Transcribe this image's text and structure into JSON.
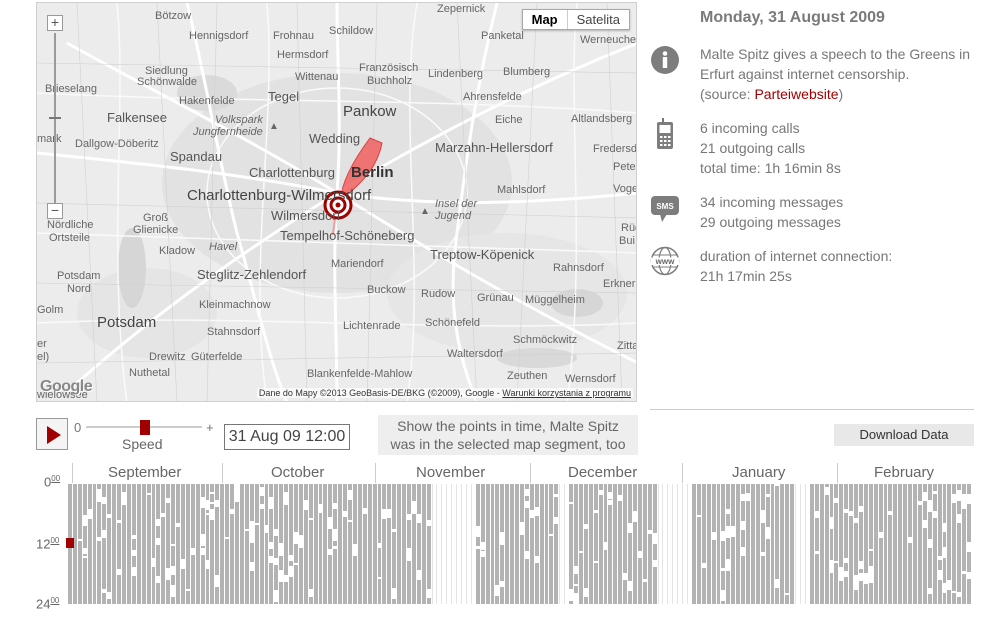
{
  "map": {
    "toggle": {
      "map_label": "Map",
      "satellite_label": "Satelita"
    },
    "zoom": {
      "plus": "+",
      "minus": "−"
    },
    "places": {
      "zepernick": "Zepernick",
      "botzow": "Bötzow",
      "hennigsdorf": "Hennigsdorf",
      "frohnau": "Frohnau",
      "schildow": "Schildow",
      "panketal": "Panketal",
      "werneuchen": "Werneuchen",
      "hermsdorf": "Hermsdorf",
      "siedlung": "Siedlung",
      "schonwalde": "Schönwalde",
      "wittenau": "Wittenau",
      "franzosisch": "Französisch",
      "buchholz": "Buchholz",
      "lindenberg": "Lindenberg",
      "blumberg": "Blumberg",
      "brieselang": "Brieselang",
      "hakenfelde": "Hakenfelde",
      "tegel": "Tegel",
      "ahrensfelde": "Ahrensfelde",
      "pankow": "Pankow",
      "falkensee": "Falkensee",
      "volkspark": "Volkspark",
      "jungfernheide": "Jungfernheide",
      "eiche": "Eiche",
      "altlandsberg": "Altlandsberg",
      "mark": "mark",
      "dallgow": "Dallgow-Döberitz",
      "wedding": "Wedding",
      "marzahn": "Marzahn-Hellersdorf",
      "fredersdorf": "Fredersd",
      "spandau": "Spandau",
      "charlottenburg": "Charlottenburg",
      "berlin": "Berlin",
      "petershagen": "Peter",
      "charlottenburg_wilm": "Charlottenburg-Wilmersdorf",
      "mahlsdorf": "Mahlsdorf",
      "vogelsdorf": "Vogels",
      "insel": "Insel der",
      "jugend": "Jugend",
      "wilmersdorf": "Wilmersdorf",
      "nordliche": "Nördliche",
      "ortsteile": "Ortsteile",
      "gross": "Groß",
      "glienicke": "Glienicke",
      "tempelhof": "Tempelhof-Schöneberg",
      "rud": "Rüd",
      "bui": "Bui",
      "havel": "Havel",
      "kladow": "Kladow",
      "treptow": "Treptow-Köpenick",
      "mariendorf": "Mariendorf",
      "potsdam_nord": "Potsdam",
      "nord": "Nord",
      "steglitz": "Steglitz-Zehlendorf",
      "rahnsdorf": "Rahnsdorf",
      "erkner": "Erkner",
      "buckow": "Buckow",
      "rudow": "Rudow",
      "grunau": "Grünau",
      "muggelheim": "Müggelheim",
      "golm": "Golm",
      "kleinmachnow": "Kleinmachnow",
      "potsdam": "Potsdam",
      "schonefeld": "Schönefeld",
      "stahnsdorf": "Stahnsdorf",
      "lichtenrade": "Lichtenrade",
      "schmockwitz": "Schmöckwitz",
      "zitta": "Zitta",
      "er": "er",
      "el": "el)",
      "drewitz": "Drewitz",
      "guterfelde": "Güterfelde",
      "waltersdorf": "Waltersdorf",
      "nuthetal": "Nuthetal",
      "blankenfelde": "Blankenfelde-Mahlow",
      "zeuthen": "Zeuthen",
      "wernsdorf": "Wernsdorf",
      "wielowsee": "wielowsee"
    },
    "google_logo": "Google",
    "attribution_text": "Dane do Mapy ©2013 GeoBasis-DE/BKG (©2009), Google - ",
    "attribution_link": "Warunki korzystania z programu",
    "track_color": "#f06060",
    "marker_color": "#a10000"
  },
  "info": {
    "date": "Monday, 31 August 2009",
    "event": {
      "icon": "info-icon",
      "line1": "Malte Spitz gives a speech to the Greens in",
      "line2": "Erfurt against internet censorship.",
      "source_prefix": "(source: ",
      "source_link": "Parteiwebsite",
      "source_suffix": ")"
    },
    "calls": {
      "icon": "phone-icon",
      "incoming": "6 incoming calls",
      "outgoing": "21 outgoing calls",
      "total": "total time: 1h 16min 8s"
    },
    "sms": {
      "icon": "sms-icon",
      "icon_label": "SMS",
      "incoming": "34 incoming messages",
      "outgoing": "29 outgoing messages"
    },
    "internet": {
      "icon": "www-icon",
      "icon_label": "www",
      "label": "duration of internet connection:",
      "value": "21h 17min 25s"
    }
  },
  "controls": {
    "speed_min": "0",
    "speed_max": "+",
    "speed_label": "Speed",
    "speed_value": 0.5,
    "current_time": "31 Aug 09 12:00",
    "hint_line1": "Show the points in time, Malte Spitz",
    "hint_line2": "was in the selected map segment, too",
    "download_label": "Download Data"
  },
  "timeline": {
    "months": [
      "September",
      "October",
      "November",
      "December",
      "January",
      "February"
    ],
    "hours": [
      {
        "num": "0",
        "sup": "00"
      },
      {
        "num": "12",
        "sup": "00"
      },
      {
        "num": "24",
        "sup": "00"
      }
    ],
    "active_color": "#b3b3b3",
    "selected_color": "#a10000"
  }
}
